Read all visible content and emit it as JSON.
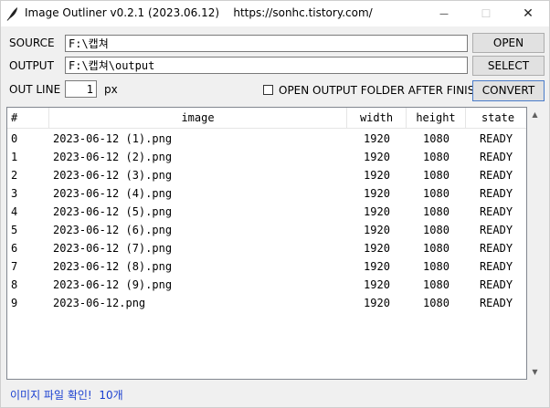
{
  "titlebar": {
    "title": "Image Outliner v0.2.1 (2023.06.12)    https://sonhc.tistory.com/",
    "minimize_glyph": "—",
    "maximize_glyph": "☐",
    "close_glyph": "✕"
  },
  "form": {
    "source_label": "SOURCE",
    "source_value": "F:\\캡쳐",
    "output_label": "OUTPUT",
    "output_value": "F:\\캡쳐\\output",
    "outline_label": "OUT LINE",
    "outline_value": "1",
    "outline_unit": "px",
    "open_folder_label": "OPEN OUTPUT FOLDER AFTER FINISH",
    "open_button": "OPEN",
    "select_button": "SELECT",
    "convert_button": "CONVERT"
  },
  "table": {
    "columns": [
      "#",
      "image",
      "width",
      "height",
      "state"
    ],
    "rows": [
      [
        "0",
        "2023-06-12 (1).png",
        "1920",
        "1080",
        "READY"
      ],
      [
        "1",
        "2023-06-12 (2).png",
        "1920",
        "1080",
        "READY"
      ],
      [
        "2",
        "2023-06-12 (3).png",
        "1920",
        "1080",
        "READY"
      ],
      [
        "3",
        "2023-06-12 (4).png",
        "1920",
        "1080",
        "READY"
      ],
      [
        "4",
        "2023-06-12 (5).png",
        "1920",
        "1080",
        "READY"
      ],
      [
        "5",
        "2023-06-12 (6).png",
        "1920",
        "1080",
        "READY"
      ],
      [
        "6",
        "2023-06-12 (7).png",
        "1920",
        "1080",
        "READY"
      ],
      [
        "7",
        "2023-06-12 (8).png",
        "1920",
        "1080",
        "READY"
      ],
      [
        "8",
        "2023-06-12 (9).png",
        "1920",
        "1080",
        "READY"
      ],
      [
        "9",
        "2023-06-12.png",
        "1920",
        "1080",
        "READY"
      ]
    ]
  },
  "status": {
    "text": "이미지 파일 확인!  10개",
    "color": "#1a3fd0"
  },
  "icons": {
    "app": "feather-icon",
    "scroll_up": "scroll-up-arrow-icon",
    "scroll_down": "scroll-down-arrow-icon"
  }
}
